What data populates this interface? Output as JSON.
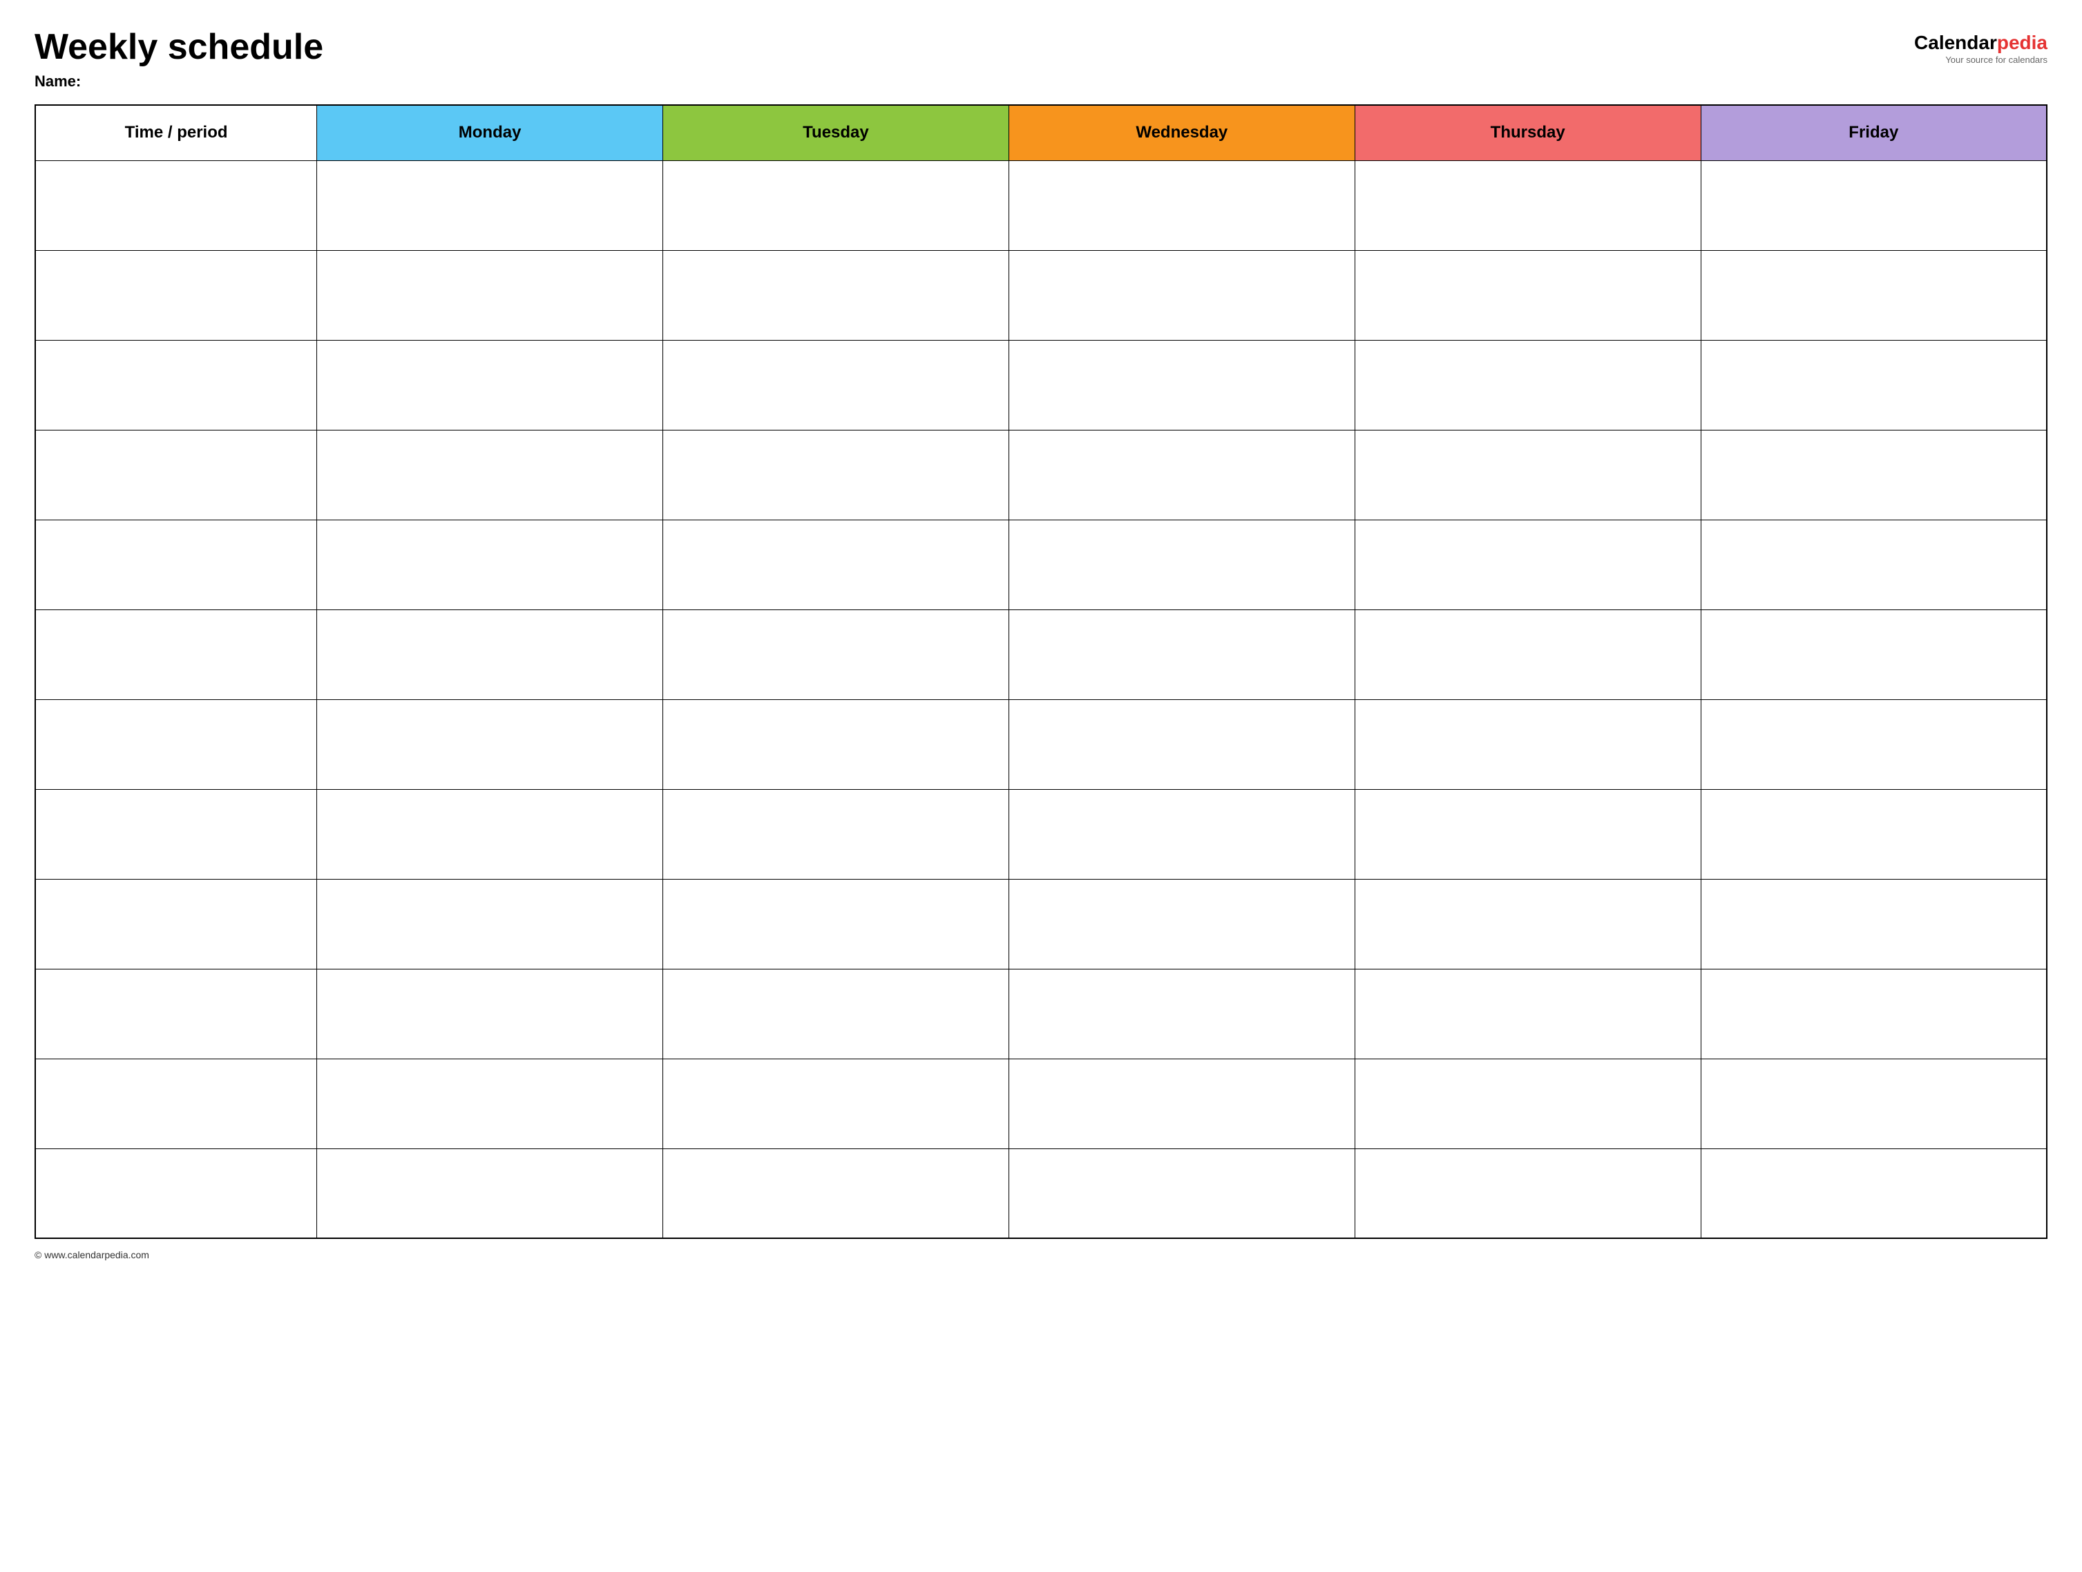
{
  "header": {
    "title": "Weekly schedule",
    "name_label": "Name:",
    "logo": {
      "calendar": "Calendar",
      "pedia": "pedia",
      "tagline": "Your source for calendars"
    }
  },
  "table": {
    "columns": [
      {
        "key": "time",
        "label": "Time / period",
        "color_class": "th-time"
      },
      {
        "key": "monday",
        "label": "Monday",
        "color_class": "th-monday"
      },
      {
        "key": "tuesday",
        "label": "Tuesday",
        "color_class": "th-tuesday"
      },
      {
        "key": "wednesday",
        "label": "Wednesday",
        "color_class": "th-wednesday"
      },
      {
        "key": "thursday",
        "label": "Thursday",
        "color_class": "th-thursday"
      },
      {
        "key": "friday",
        "label": "Friday",
        "color_class": "th-friday"
      }
    ],
    "row_count": 12
  },
  "footer": {
    "copyright": "© www.calendarpedia.com"
  }
}
